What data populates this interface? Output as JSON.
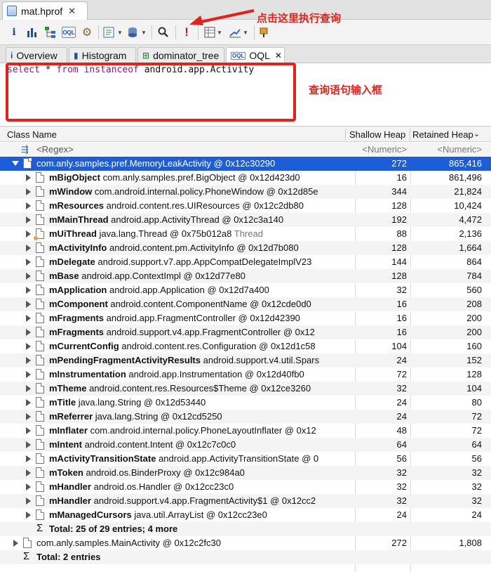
{
  "editor_tab": {
    "title": "mat.hprof",
    "close_glyph": "✕"
  },
  "annotations": {
    "toolbar_hint": "点击这里执行查询",
    "editor_hint": "查询语句输入框"
  },
  "view_tabs": [
    {
      "label": "Overview",
      "icon": "info-icon",
      "glyph": "i"
    },
    {
      "label": "Histogram",
      "icon": "histogram-icon",
      "glyph": "▮"
    },
    {
      "label": "dominator_tree",
      "icon": "dominator-tree-icon",
      "glyph": "⊞"
    },
    {
      "label": "OQL",
      "icon": "oql-icon",
      "glyph": "OQL",
      "active": true,
      "close_glyph": "✕"
    }
  ],
  "query": {
    "select": "select",
    "star": " * ",
    "from": "from",
    "instanceof": "instanceof",
    "class": " android.app.Activity"
  },
  "columns": {
    "name": "Class Name",
    "shallow": "Shallow Heap",
    "retained": "Retained Heap",
    "retained_sort": "⌄"
  },
  "filter_row": {
    "name": "<Regex>",
    "shallow": "<Numeric>",
    "retained": "<Numeric>"
  },
  "root_row": {
    "name": "com.anly.samples.pref.MemoryLeakActivity @ 0x12c30290",
    "shallow": "272",
    "retained": "865,416"
  },
  "fields": [
    {
      "field": "mBigObject",
      "desc": "com.anly.samples.pref.BigObject @ 0x12d423d0",
      "shallow": "16",
      "retained": "861,496"
    },
    {
      "field": "mWindow",
      "desc": "com.android.internal.policy.PhoneWindow @ 0x12d85e",
      "shallow": "344",
      "retained": "21,824"
    },
    {
      "field": "mResources",
      "desc": "android.content.res.UIResources @ 0x12c2db80",
      "shallow": "128",
      "retained": "10,424"
    },
    {
      "field": "mMainThread",
      "desc": "android.app.ActivityThread @ 0x12c3a140",
      "shallow": "192",
      "retained": "4,472"
    },
    {
      "field": "mUiThread",
      "desc": "java.lang.Thread @ 0x75b012a8",
      "extra": " Thread",
      "thread": true,
      "shallow": "88",
      "retained": "2,136"
    },
    {
      "field": "mActivityInfo",
      "desc": "android.content.pm.ActivityInfo @ 0x12d7b080",
      "shallow": "128",
      "retained": "1,664"
    },
    {
      "field": "mDelegate",
      "desc": "android.support.v7.app.AppCompatDelegateImplV23",
      "shallow": "144",
      "retained": "864"
    },
    {
      "field": "mBase",
      "desc": "android.app.ContextImpl @ 0x12d77e80",
      "shallow": "128",
      "retained": "784"
    },
    {
      "field": "mApplication",
      "desc": "android.app.Application @ 0x12d7a400",
      "shallow": "32",
      "retained": "560"
    },
    {
      "field": "mComponent",
      "desc": "android.content.ComponentName @ 0x12cde0d0",
      "shallow": "16",
      "retained": "208"
    },
    {
      "field": "mFragments",
      "desc": "android.app.FragmentController @ 0x12d42390",
      "shallow": "16",
      "retained": "200"
    },
    {
      "field": "mFragments",
      "desc": "android.support.v4.app.FragmentController @ 0x12",
      "shallow": "16",
      "retained": "200"
    },
    {
      "field": "mCurrentConfig",
      "desc": "android.content.res.Configuration @ 0x12d1c58",
      "shallow": "104",
      "retained": "160"
    },
    {
      "field": "mPendingFragmentActivityResults",
      "desc": "android.support.v4.util.Spars",
      "shallow": "24",
      "retained": "152"
    },
    {
      "field": "mInstrumentation",
      "desc": "android.app.Instrumentation @ 0x12d40fb0",
      "shallow": "72",
      "retained": "128"
    },
    {
      "field": "mTheme",
      "desc": "android.content.res.Resources$Theme @ 0x12ce3260",
      "shallow": "32",
      "retained": "104"
    },
    {
      "field": "mTitle",
      "desc": "java.lang.String @ 0x12d53440",
      "shallow": "24",
      "retained": "80"
    },
    {
      "field": "mReferrer",
      "desc": "java.lang.String @ 0x12cd5250",
      "shallow": "24",
      "retained": "72"
    },
    {
      "field": "mInflater",
      "desc": "com.android.internal.policy.PhoneLayoutInflater @ 0x12",
      "shallow": "48",
      "retained": "72"
    },
    {
      "field": "mIntent",
      "desc": "android.content.Intent @ 0x12c7c0c0",
      "shallow": "64",
      "retained": "64"
    },
    {
      "field": "mActivityTransitionState",
      "desc": "android.app.ActivityTransitionState @ 0",
      "shallow": "56",
      "retained": "56"
    },
    {
      "field": "mToken",
      "desc": "android.os.BinderProxy @ 0x12c984a0",
      "shallow": "32",
      "retained": "32"
    },
    {
      "field": "mHandler",
      "desc": "android.os.Handler @ 0x12cc23c0",
      "shallow": "32",
      "retained": "32"
    },
    {
      "field": "mHandler",
      "desc": "android.support.v4.app.FragmentActivity$1 @ 0x12cc2",
      "shallow": "32",
      "retained": "32"
    },
    {
      "field": "mManagedCursors",
      "desc": "java.util.ArrayList @ 0x12cc23e0",
      "shallow": "24",
      "retained": "24"
    }
  ],
  "fields_total": "Total: 25 of 29 entries; 4 more",
  "second_row": {
    "name": "com.anly.samples.MainActivity @ 0x12c2fc30",
    "shallow": "272",
    "retained": "1,808"
  },
  "grand_total": "Total: 2 entries",
  "colors": {
    "selection": "#1d5ed8",
    "annotation": "#e2231a",
    "keyword": "#7f1d7f"
  }
}
